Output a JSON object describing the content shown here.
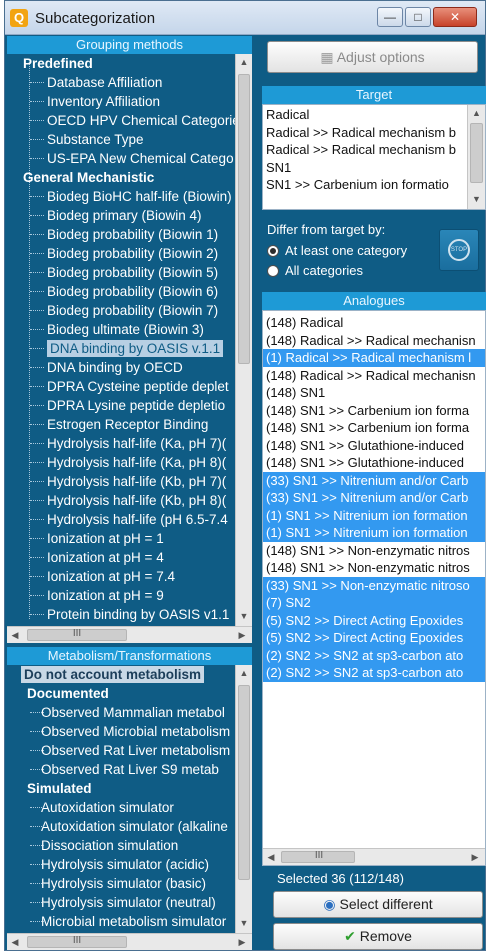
{
  "window": {
    "title": "Subcategorization",
    "app_icon": "Q"
  },
  "grouping": {
    "header": "Grouping methods",
    "predefined_label": "Predefined",
    "predefined_items": [
      "Database Affiliation",
      "Inventory Affiliation",
      "OECD HPV Chemical Categorie",
      "Substance Type",
      "US-EPA New Chemical Catego"
    ],
    "general_label": "General Mechanistic",
    "general_items": [
      "Biodeg BioHC half-life (Biowin)",
      "Biodeg primary (Biowin 4)",
      "Biodeg probability (Biowin 1)",
      "Biodeg probability (Biowin 2)",
      "Biodeg probability (Biowin 5)",
      "Biodeg probability (Biowin 6)",
      "Biodeg probability (Biowin 7)",
      "Biodeg ultimate (Biowin 3)",
      "DNA binding by OASIS v.1.1",
      "DNA binding by OECD",
      "DPRA Cysteine peptide deplet",
      "DPRA Lysine peptide depletio",
      "Estrogen Receptor Binding",
      "Hydrolysis half-life (Ka, pH 7)(",
      "Hydrolysis half-life (Ka, pH 8)(",
      "Hydrolysis half-life (Kb, pH 7)(",
      "Hydrolysis half-life (Kb, pH 8)(",
      "Hydrolysis half-life (pH 6.5-7.4",
      "Ionization at pH = 1",
      "Ionization at pH = 4",
      "Ionization at pH = 7.4",
      "Ionization at pH = 9",
      "Protein binding by OASIS v1.1"
    ],
    "selected_index": 8
  },
  "metabolism": {
    "header": "Metabolism/Transformations",
    "do_not_account": "Do not account metabolism",
    "documented_label": "Documented",
    "documented_items": [
      "Observed Mammalian metabol",
      "Observed Microbial metabolism",
      "Observed Rat Liver metabolism",
      "Observed Rat Liver S9  metab"
    ],
    "simulated_label": "Simulated",
    "simulated_items": [
      "Autoxidation simulator",
      "Autoxidation simulator (alkaline",
      "Dissociation simulation",
      "Hydrolysis simulator (acidic)",
      "Hydrolysis simulator (basic)",
      "Hydrolysis simulator (neutral)",
      "Microbial metabolism simulator"
    ]
  },
  "adjust_options_label": "Adjust options",
  "target": {
    "header": "Target",
    "rows": [
      "Radical",
      "Radical >> Radical mechanism b",
      "Radical >> Radical mechanism b",
      "SN1",
      "SN1 >> Carbenium ion formatio"
    ]
  },
  "differ": {
    "label": "Differ from target by:",
    "option_one": "At least one category",
    "option_all": "All categories",
    "selected": "option_one"
  },
  "analogues": {
    "header": "Analogues",
    "rows": [
      {
        "text": "(148) Radical",
        "selected": false
      },
      {
        "text": "(148) Radical >> Radical mechanisn",
        "selected": false
      },
      {
        "text": "(1) Radical >> Radical mechanism l",
        "selected": true
      },
      {
        "text": "(148) Radical >> Radical mechanisn",
        "selected": false
      },
      {
        "text": "(148) SN1",
        "selected": false
      },
      {
        "text": "(148) SN1 >> Carbenium ion forma",
        "selected": false
      },
      {
        "text": "(148) SN1 >> Carbenium ion forma",
        "selected": false
      },
      {
        "text": "(148) SN1 >> Glutathione-induced",
        "selected": false
      },
      {
        "text": "(148) SN1 >> Glutathione-induced",
        "selected": false
      },
      {
        "text": "(33) SN1 >> Nitrenium and/or Carb",
        "selected": true
      },
      {
        "text": "(33) SN1 >> Nitrenium and/or Carb",
        "selected": true
      },
      {
        "text": "(1) SN1 >> Nitrenium ion formation",
        "selected": true
      },
      {
        "text": "(1) SN1 >> Nitrenium ion formation",
        "selected": true
      },
      {
        "text": "(148) SN1 >> Non-enzymatic nitros",
        "selected": false
      },
      {
        "text": "(148) SN1 >> Non-enzymatic nitros",
        "selected": false
      },
      {
        "text": "(33) SN1 >> Non-enzymatic nitroso",
        "selected": true
      },
      {
        "text": "(7) SN2",
        "selected": true
      },
      {
        "text": "(5) SN2 >> Direct Acting Epoxides",
        "selected": true
      },
      {
        "text": "(5) SN2 >> Direct Acting Epoxides",
        "selected": true
      },
      {
        "text": "(2) SN2 >> SN2 at sp3-carbon ato",
        "selected": true
      },
      {
        "text": "(2) SN2 >> SN2 at sp3-carbon ato",
        "selected": true
      }
    ]
  },
  "selected_text": "Selected 36 (112/148)",
  "select_different_label": "Select different",
  "remove_label": "Remove",
  "scroll_grip": "III",
  "stop_icon_text": "STOP"
}
